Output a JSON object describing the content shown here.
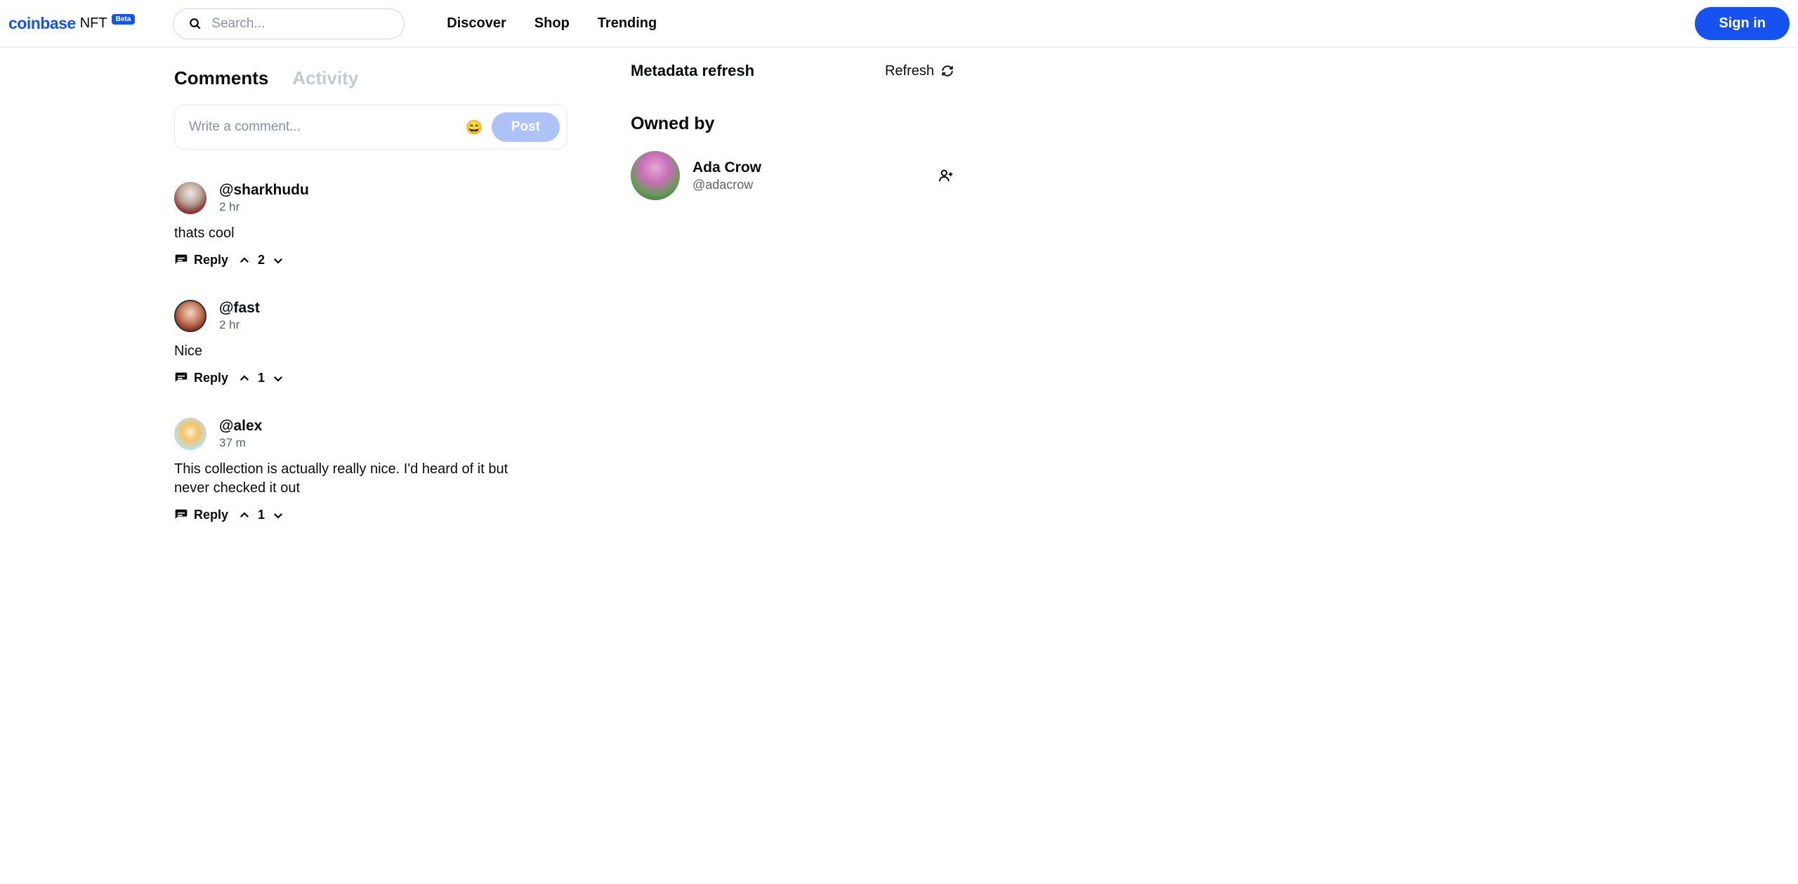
{
  "header": {
    "logo_coinbase": "coinbase",
    "logo_nft": "NFT",
    "beta": "Beta",
    "search_placeholder": "Search...",
    "nav": {
      "discover": "Discover",
      "shop": "Shop",
      "trending": "Trending"
    },
    "signin": "Sign in"
  },
  "tabs": {
    "comments": "Comments",
    "activity": "Activity"
  },
  "comment_box": {
    "placeholder": "Write a comment...",
    "post": "Post"
  },
  "comments": [
    {
      "user": "@sharkhudu",
      "time": "2 hr",
      "body": "thats cool",
      "reply": "Reply",
      "votes": "2"
    },
    {
      "user": "@fast",
      "time": "2 hr",
      "body": "Nice",
      "reply": "Reply",
      "votes": "1"
    },
    {
      "user": "@alex",
      "time": "37 m",
      "body": "This collection is actually really nice. I'd heard of it but never checked it out",
      "reply": "Reply",
      "votes": "1"
    }
  ],
  "right": {
    "metadata_title": "Metadata refresh",
    "refresh": "Refresh",
    "owned_by": "Owned by",
    "owner_name": "Ada Crow",
    "owner_handle": "@adacrow"
  }
}
